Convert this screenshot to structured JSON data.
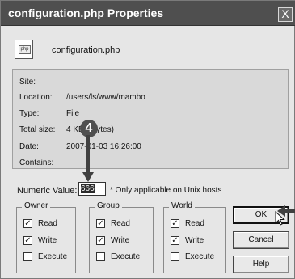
{
  "window": {
    "title": "configuration.php Properties",
    "close_label": "X"
  },
  "file": {
    "icon": "php-file-icon",
    "icon_text": "php",
    "name": "configuration.php"
  },
  "info": {
    "rows": [
      {
        "label": "Site:",
        "value": ""
      },
      {
        "label": "Location:",
        "value": "/users/ls/www/mambo"
      },
      {
        "label": "Type:",
        "value": "File"
      },
      {
        "label": "Total size:",
        "value": "4 KB (   Bytes)"
      },
      {
        "label": "Date:",
        "value": "2007-01-03 16:26:00"
      },
      {
        "label": "Contains:",
        "value": ""
      }
    ]
  },
  "permissions": {
    "numeric_label": "Numeric Value:",
    "numeric_value": "666",
    "note": "* Only applicable on Unix hosts",
    "groups": [
      {
        "title": "Owner",
        "options": [
          {
            "label": "Read",
            "checked": true
          },
          {
            "label": "Write",
            "checked": true
          },
          {
            "label": "Execute",
            "checked": false
          }
        ]
      },
      {
        "title": "Group",
        "options": [
          {
            "label": "Read",
            "checked": true
          },
          {
            "label": "Write",
            "checked": true
          },
          {
            "label": "Execute",
            "checked": false
          }
        ]
      },
      {
        "title": "World",
        "options": [
          {
            "label": "Read",
            "checked": true
          },
          {
            "label": "Write",
            "checked": true
          },
          {
            "label": "Execute",
            "checked": false
          }
        ]
      }
    ]
  },
  "buttons": {
    "ok": "OK",
    "cancel": "Cancel",
    "help": "Help"
  },
  "callout": {
    "number": "4"
  },
  "colors": {
    "titlebar": "#4f4f4f",
    "dialog": "#e6e6e6"
  }
}
